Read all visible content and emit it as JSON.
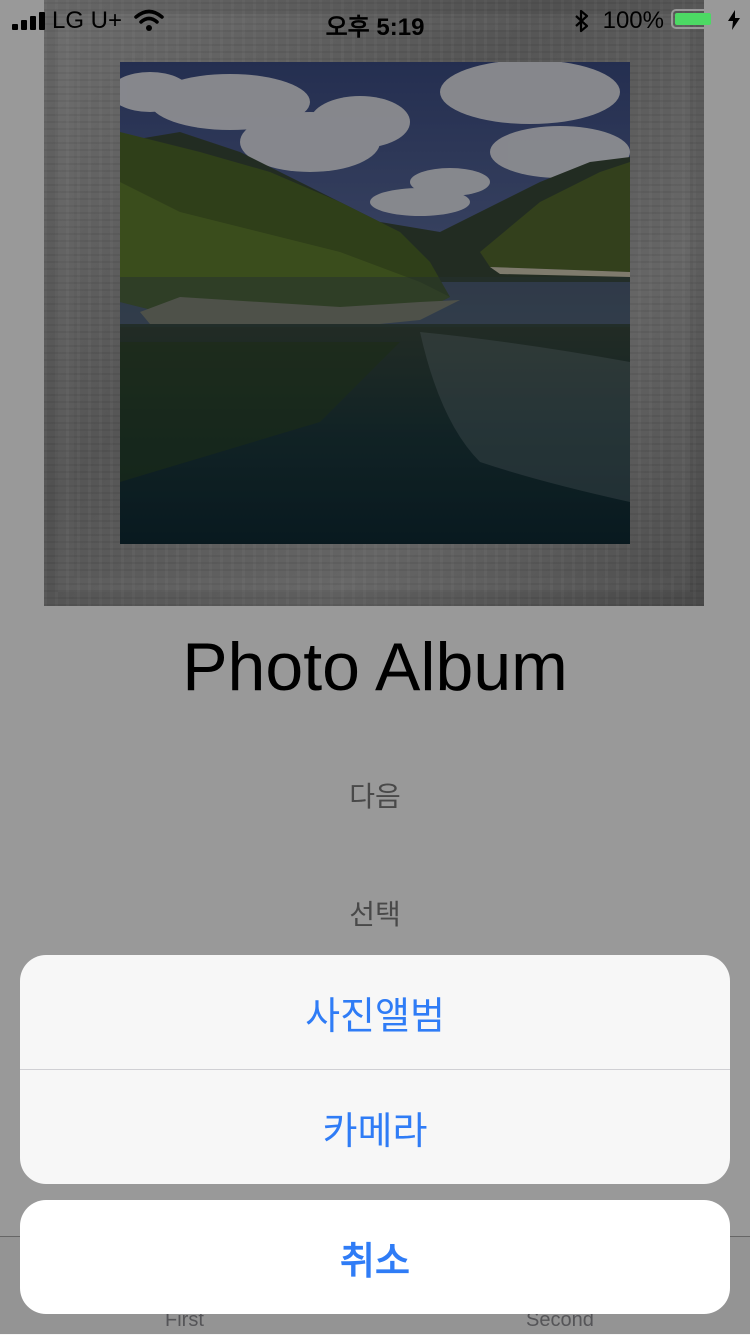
{
  "status_bar": {
    "carrier": "LG U+",
    "time": "오후 5:19",
    "battery_percent": "100%",
    "battery_color": "#4cd964"
  },
  "main": {
    "title": "Photo Album",
    "next_button": "다음",
    "select_button": "선택"
  },
  "tab_bar": {
    "tabs": [
      {
        "label": "First"
      },
      {
        "label": "Second"
      }
    ]
  },
  "action_sheet": {
    "items": [
      {
        "label": "사진앨범"
      },
      {
        "label": "카메라"
      }
    ],
    "cancel_label": "취소",
    "accent_color": "#2f7cf6"
  },
  "icons": [
    "signal-icon",
    "wifi-icon",
    "bluetooth-icon",
    "battery-icon",
    "charging-icon"
  ]
}
